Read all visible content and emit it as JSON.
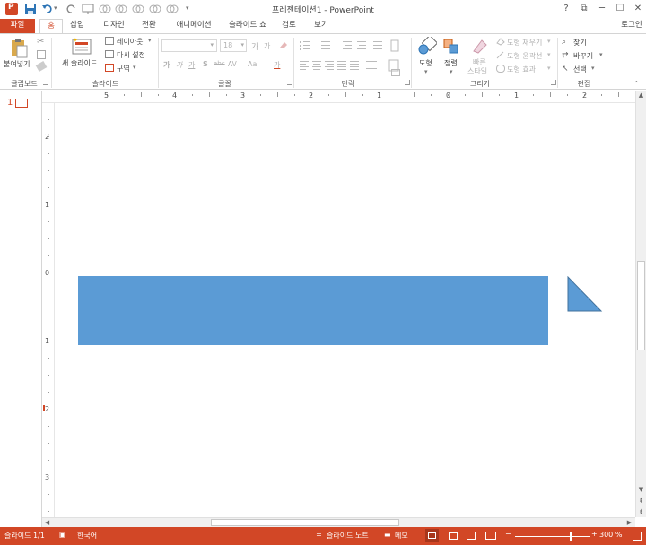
{
  "app": {
    "title": "프레젠테이션1 - PowerPoint",
    "accent_color": "#d24726",
    "shape_color": "#5b9bd5"
  },
  "window_controls": {
    "help": "?",
    "restore": "⧉",
    "minimize": "─",
    "maximize": "☐",
    "close": "✕",
    "signin": "로그인"
  },
  "tabs": [
    "파일",
    "홈",
    "삽입",
    "디자인",
    "전환",
    "애니메이션",
    "슬라이드 쇼",
    "검토",
    "보기"
  ],
  "ribbon": {
    "clipboard": {
      "paste": "붙여넣기",
      "group": "클립보드"
    },
    "slides": {
      "new_slide": "새 슬라이드",
      "layout": "레이아웃",
      "reset": "다시 설정",
      "section": "구역",
      "group": "슬라이드"
    },
    "font": {
      "font_size": "18",
      "grow": "가",
      "shrink": "가",
      "bold": "가",
      "italic": "가",
      "underline": "가",
      "strike": "S",
      "char_spacing": "abc",
      "spacing": "AV",
      "case": "Aa",
      "color": "가",
      "group": "글꼴"
    },
    "paragraph": {
      "group": "단락"
    },
    "drawing": {
      "shapes": "도형",
      "arrange": "정렬",
      "quick_styles_1": "빠른",
      "quick_styles_2": "스타일",
      "fill": "도형 채우기",
      "outline": "도형 윤곽선",
      "effects": "도형 효과",
      "group": "그리기"
    },
    "editing": {
      "find": "찾기",
      "replace": "바꾸기",
      "select": "선택",
      "group": "편집"
    }
  },
  "slide_panel": {
    "slide_number": "1"
  },
  "ruler": {
    "horizontal": [
      "5",
      "4",
      "3",
      "2",
      "1",
      "0",
      "1",
      "2"
    ],
    "vertical": [
      "2",
      "1",
      "0",
      "1",
      "2",
      "3"
    ]
  },
  "statusbar": {
    "slide_info": "슬라이드 1/1",
    "language": "한국어",
    "notes": "슬라이드 노트",
    "comments": "메모",
    "zoom": "300 %"
  }
}
